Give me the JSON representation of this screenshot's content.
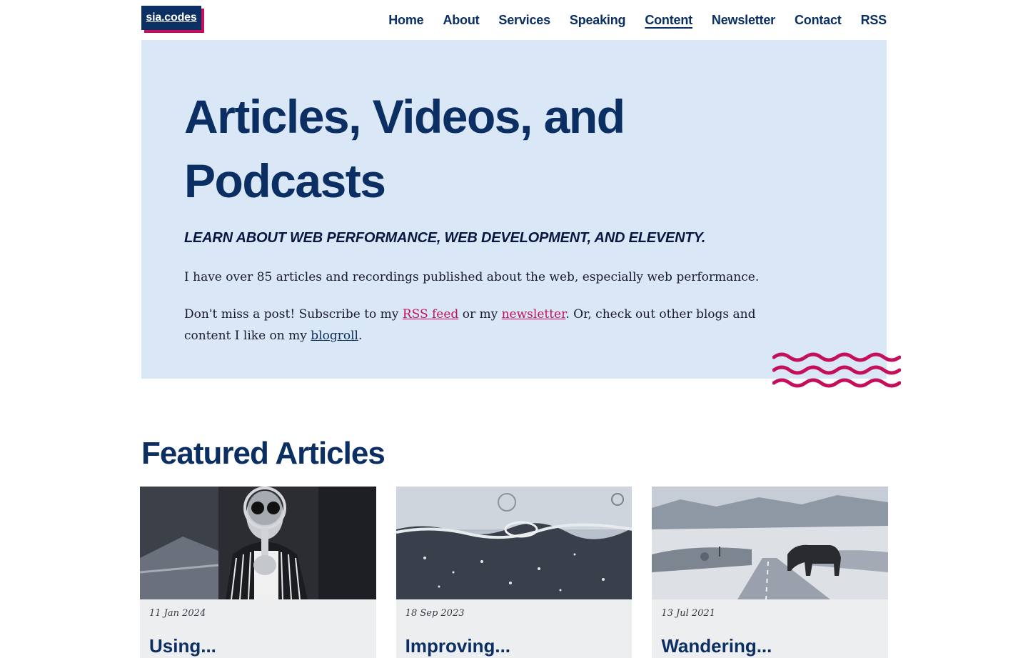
{
  "header": {
    "logo": "sia.codes",
    "nav": [
      {
        "label": "Home",
        "active": false
      },
      {
        "label": "About",
        "active": false
      },
      {
        "label": "Services",
        "active": false
      },
      {
        "label": "Speaking",
        "active": false
      },
      {
        "label": "Content",
        "active": true
      },
      {
        "label": "Newsletter",
        "active": false
      },
      {
        "label": "Contact",
        "active": false
      },
      {
        "label": "RSS",
        "active": false
      }
    ]
  },
  "hero": {
    "title": "Articles, Videos, and Podcasts",
    "tagline": "LEARN ABOUT WEB PERFORMANCE, WEB DEVELOPMENT, AND ELEVENTY.",
    "intro": "I have over 85 articles and recordings published about the web, especially web performance.",
    "subscribe": {
      "prefix": "Don't miss a post! Subscribe to my ",
      "rss_link": "RSS feed",
      "middle": " or my ",
      "newsletter_link": "newsletter",
      "after": ". Or, check out other blogs and content I like on my ",
      "blogroll_link": "blogroll",
      "suffix": "."
    }
  },
  "featured": {
    "title": "Featured Articles",
    "cards": [
      {
        "date": "11 Jan 2024",
        "title": "Using..."
      },
      {
        "date": "18 Sep 2023",
        "title": "Improving..."
      },
      {
        "date": "13 Jul 2021",
        "title": "Wandering..."
      }
    ]
  },
  "colors": {
    "primary": "#0b2f63",
    "accent": "#c4105a",
    "hero_bg": "#d9e7f7",
    "card_bg": "#eceeef"
  }
}
